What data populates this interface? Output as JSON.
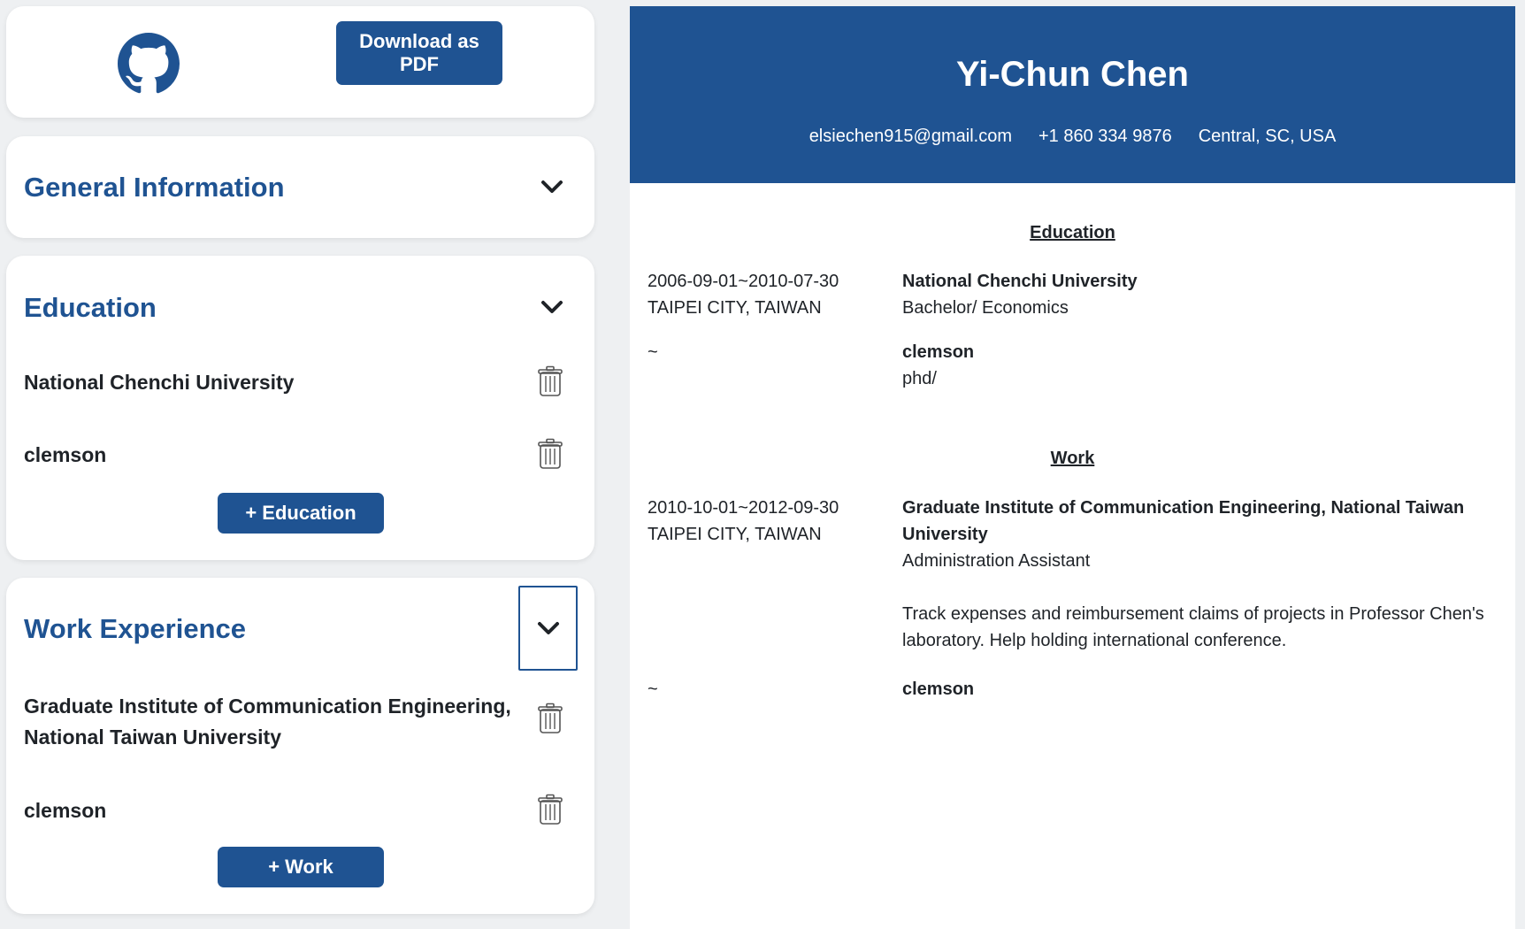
{
  "toolbar": {
    "github_icon": "github-icon",
    "download_label": "Download as PDF"
  },
  "general": {
    "title": "General Information"
  },
  "education": {
    "title": "Education",
    "items": [
      {
        "name": "National Chenchi University"
      },
      {
        "name": "clemson"
      }
    ],
    "add_label": "+ Education"
  },
  "work": {
    "title": "Work Experience",
    "items": [
      {
        "name": "Graduate Institute of Communication Engineering, National Taiwan University"
      },
      {
        "name": "clemson"
      }
    ],
    "add_label": "+ Work"
  },
  "resume": {
    "name": "Yi-Chun Chen",
    "email": "elsiechen915@gmail.com",
    "phone": "+1 860 334 9876",
    "location": "Central, SC, USA",
    "education_heading": "Education",
    "education": [
      {
        "dates": "2006-09-01~2010-07-30",
        "place": "TAIPEI CITY, TAIWAN",
        "school": "National Chenchi University",
        "degree": "Bachelor/ Economics"
      },
      {
        "dates": "~",
        "place": "",
        "school": "clemson",
        "degree": "phd/"
      }
    ],
    "work_heading": "Work",
    "work": [
      {
        "dates": "2010-10-01~2012-09-30",
        "place": "TAIPEI CITY, TAIWAN",
        "company": "Graduate Institute of Communication Engineering, National Taiwan University",
        "position": "Administration Assistant",
        "description": "Track expenses and reimbursement claims of projects in Professor Chen's laboratory. Help holding international conference."
      },
      {
        "dates": "~",
        "place": "",
        "company": "clemson",
        "position": "",
        "description": ""
      }
    ]
  },
  "colors": {
    "accent": "#1f5392",
    "background": "#eef0f2",
    "card": "#ffffff"
  }
}
